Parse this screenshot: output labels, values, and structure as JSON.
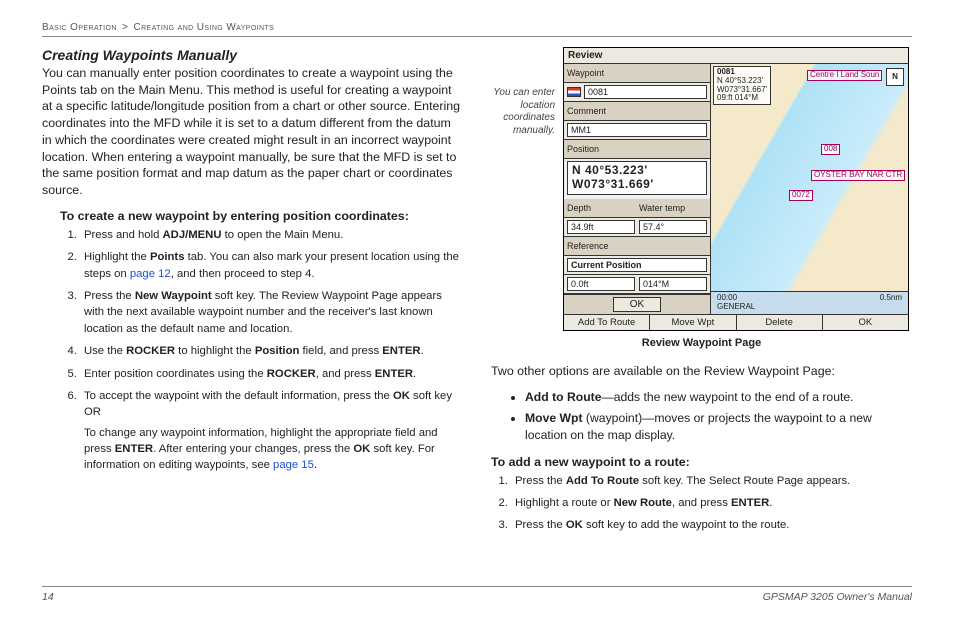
{
  "breadcrumb": {
    "section": "Basic Operation",
    "sep": ">",
    "subsection": "Creating and Using Waypoints"
  },
  "left": {
    "heading": "Creating Waypoints Manually",
    "intro": "You can manually enter position coordinates to create a waypoint using the Points tab on the Main Menu. This method is useful for creating a waypoint at a specific latitude/longitude position from a chart or other source. Entering coordinates into the MFD while it is set to a datum different from the datum in which the coordinates were created might result in an incorrect waypoint location. When entering a waypoint manually, be sure that the MFD is set to the same position format and map datum as the paper chart or coordinates source.",
    "proc_heading": "To create a new waypoint by entering position coordinates:",
    "steps": [
      {
        "pre": "Press and hold ",
        "b1": "ADJ/MENU",
        "post": " to open the Main Menu."
      },
      {
        "pre": "Highlight the ",
        "b1": "Points",
        "mid": " tab. You can also mark your present location using the steps on ",
        "link": "page 12",
        "post": ", and then proceed to step 4."
      },
      {
        "pre": "Press the ",
        "b1": "New Waypoint",
        "post": " soft key. The Review Waypoint Page appears with the next available waypoint number and the receiver's last known location as the default name and location."
      },
      {
        "pre": "Use the ",
        "b1": "ROCKER",
        "mid": " to highlight the ",
        "b2": "Position",
        "mid2": " field, and press ",
        "b3": "ENTER",
        "post": "."
      },
      {
        "pre": "Enter position coordinates using the ",
        "b1": "ROCKER",
        "mid": ", and press ",
        "b2": "ENTER",
        "post": "."
      },
      {
        "pre": "To accept the waypoint with the default information, press the ",
        "b1": "OK",
        "post": " soft key OR",
        "sub_pre": "To change any waypoint information, highlight the appropriate field and press ",
        "sub_b1": "ENTER",
        "sub_mid": ". After entering your changes, press the ",
        "sub_b2": "OK",
        "sub_mid2": " soft key. For information on editing waypoints, see ",
        "sub_link": "page 15",
        "sub_post": "."
      }
    ]
  },
  "right": {
    "callout": "You can enter location coordinates manually.",
    "device": {
      "title": "Review",
      "rows": {
        "waypoint_lbl": "Waypoint",
        "waypoint_val": "0081",
        "comment_lbl": "Comment",
        "comment_val": "MM1",
        "position_lbl": "Position",
        "lat": "N  40°53.223'",
        "lon": "W073°31.669'",
        "depth_lbl": "Depth",
        "depth_val": "34.9ft",
        "wtemp_lbl": "Water temp",
        "wtemp_val": "57.4°",
        "reference_lbl": "Reference",
        "curpos_lbl": "Current Position",
        "curpos_dist": "0.0ft",
        "curpos_brg": "014°M",
        "ok": "OK"
      },
      "map": {
        "info_id": "0081",
        "info_lat": "N 40°53.223'",
        "info_lon": "W073°31.667'",
        "info_brg": "09:ft   014°M",
        "compass": "N",
        "marks": {
          "m1": "Centre I Land Soun",
          "m2": "008",
          "m3": "OYSTER BAY NAR CTR",
          "m4": "0072"
        },
        "footer_time": "00:00",
        "footer_src": "GENERAL",
        "footer_scale": "0.5nm"
      },
      "softkeys": [
        "Add To Route",
        "Move Wpt",
        "Delete",
        "OK"
      ]
    },
    "fig_caption": "Review Waypoint Page",
    "other_opts": "Two other options are available on the Review Waypoint Page:",
    "bullets": [
      {
        "b": "Add to Route",
        "t": "—adds the new waypoint to the end of a route."
      },
      {
        "b": "Move Wpt",
        "paren": " (waypoint)",
        "t": "—moves or projects the waypoint to a new location on the map display."
      }
    ],
    "proc_heading": "To add a new waypoint to a route:",
    "steps": [
      {
        "pre": "Press the ",
        "b1": "Add To Route",
        "post": " soft key. The Select Route Page appears."
      },
      {
        "pre": "Highlight a route or ",
        "b1": "New Route",
        "mid": ", and press ",
        "b2": "ENTER",
        "post": "."
      },
      {
        "pre": "Press the ",
        "b1": "OK",
        "post": " soft key to add the waypoint to the route."
      }
    ]
  },
  "footer": {
    "page": "14",
    "manual": "GPSMAP 3205 Owner's Manual"
  }
}
